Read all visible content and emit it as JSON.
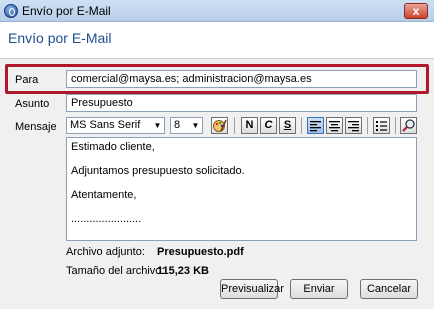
{
  "window": {
    "title": "Envío por E-Mail",
    "close_glyph": "x"
  },
  "header": {
    "title": "Envío por E-Mail"
  },
  "form": {
    "para_label": "Para",
    "para_value": "comercial@maysa.es; administracion@maysa.es",
    "asunto_label": "Asunto",
    "asunto_value": "Presupuesto",
    "mensaje_label": "Mensaje"
  },
  "toolbar": {
    "font_value": "MS Sans Serif",
    "size_value": "8",
    "bold_glyph": "N",
    "italic_glyph": "C",
    "underline_glyph": "S"
  },
  "message": {
    "lines": [
      "Estimado cliente,",
      "Adjuntamos presupuesto solicitado.",
      "Atentamente,",
      "......................."
    ]
  },
  "attachment": {
    "file_label": "Archivo adjunto:",
    "file_value": "Presupuesto.pdf",
    "size_label": "Tamaño del archivo:",
    "size_value": "115,23 KB"
  },
  "buttons": {
    "preview_label": "Previsualizar",
    "send_label": "Enviar",
    "cancel_label": "Cancelar"
  },
  "colors": {
    "highlight": "#b0182b",
    "header_text": "#1f4e8c"
  }
}
